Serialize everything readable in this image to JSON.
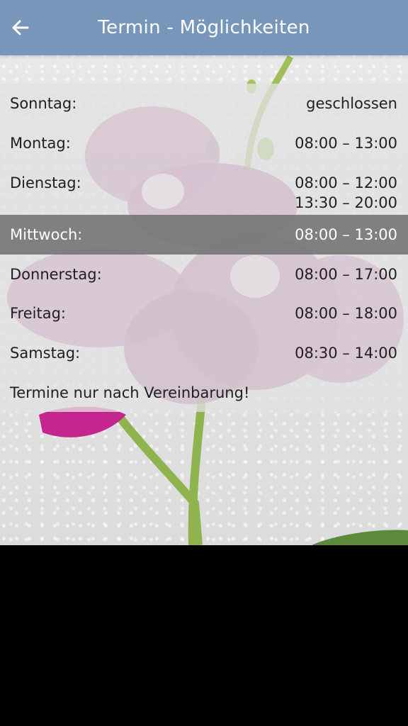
{
  "appbar": {
    "title": "Termin - Möglichkeiten",
    "back_icon": "arrow-left-icon",
    "color": "#7896b9"
  },
  "hours": [
    {
      "day": "Sonntag:",
      "times": [
        "geschlossen"
      ]
    },
    {
      "day": "Montag:",
      "times": [
        "08:00 – 13:00"
      ]
    },
    {
      "day": "Dienstag:",
      "times": [
        "08:00 – 12:00",
        "13:30 – 20:00"
      ]
    },
    {
      "day": "Mittwoch:",
      "times": [
        "08:00 – 13:00"
      ],
      "highlighted": true
    },
    {
      "day": "Donnerstag:",
      "times": [
        "08:00 – 17:00"
      ]
    },
    {
      "day": "Freitag:",
      "times": [
        "08:00 – 18:00"
      ]
    },
    {
      "day": "Samstag:",
      "times": [
        "08:30 – 14:00"
      ]
    }
  ],
  "note": "Termine nur nach Vereinbarung!",
  "background": {
    "image": "orchid-photo"
  }
}
